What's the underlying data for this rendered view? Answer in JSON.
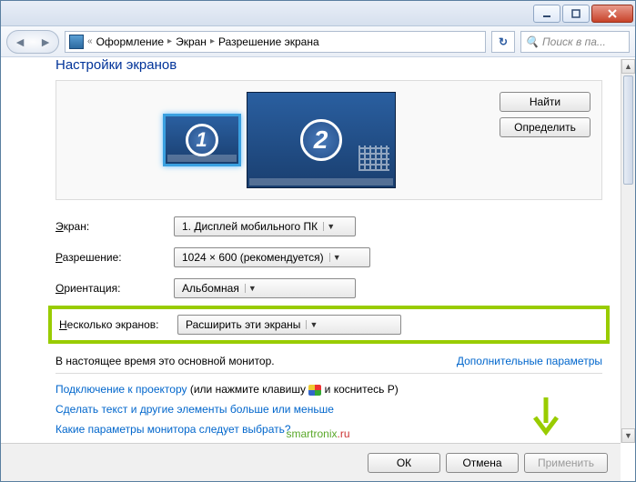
{
  "breadcrumb": {
    "items": [
      "Оформление",
      "Экран",
      "Разрешение экрана"
    ]
  },
  "search": {
    "placeholder": "Поиск в па..."
  },
  "page": {
    "title": "Настройки экранов"
  },
  "preview": {
    "monitors": [
      {
        "num": "1"
      },
      {
        "num": "2"
      }
    ],
    "buttons": {
      "find": "Найти",
      "identify": "Определить"
    }
  },
  "form": {
    "screen": {
      "label": "Экран:",
      "key": "Э",
      "value": "1. Дисплей мобильного ПК"
    },
    "resolution": {
      "label": "Разрешение:",
      "key": "Р",
      "value": "1024 × 600 (рекомендуется)"
    },
    "orientation": {
      "label": "Ориентация:",
      "key": "О",
      "value": "Альбомная"
    },
    "multi": {
      "label": "Несколько экранов:",
      "key": "Н",
      "value": "Расширить эти экраны"
    }
  },
  "status": "В настоящее время это основной монитор.",
  "links": {
    "advanced": "Дополнительные параметры",
    "projector_pre": "Подключение к проектору",
    "projector_post": " (или нажмите клавишу ",
    "projector_tail": " и коснитесь P)",
    "textsize": "Сделать текст и другие элементы больше или меньше",
    "help": "Какие параметры монитора следует выбрать"
  },
  "footer": {
    "ok": "ОК",
    "cancel": "Отмена",
    "apply": "Применить"
  },
  "watermark": {
    "a": "smartronix",
    "b": ".ru"
  }
}
